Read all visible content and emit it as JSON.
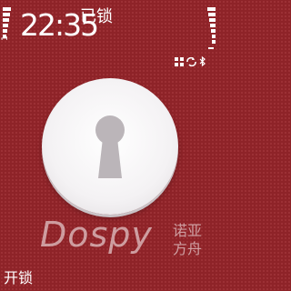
{
  "status_bar": {
    "signal_icon": "signal-strength-icon",
    "signal_label": "1",
    "battery_icon": "battery-level-icon"
  },
  "clock": {
    "time": "22:35",
    "state_label": "已锁"
  },
  "indicators": [
    {
      "icon": "grid-apps-icon"
    },
    {
      "icon": "sync-icon"
    },
    {
      "icon": "bluetooth-icon"
    }
  ],
  "lock": {
    "icon": "keyhole-icon"
  },
  "watermark": {
    "logo": "Dospy",
    "cn_line1": "诺亚",
    "cn_line2": "方舟"
  },
  "softkeys": {
    "left_label": "开锁"
  },
  "colors": {
    "background": "#8e2328",
    "disc": "#f4f2f4",
    "keyhole": "#b9b3b7"
  }
}
